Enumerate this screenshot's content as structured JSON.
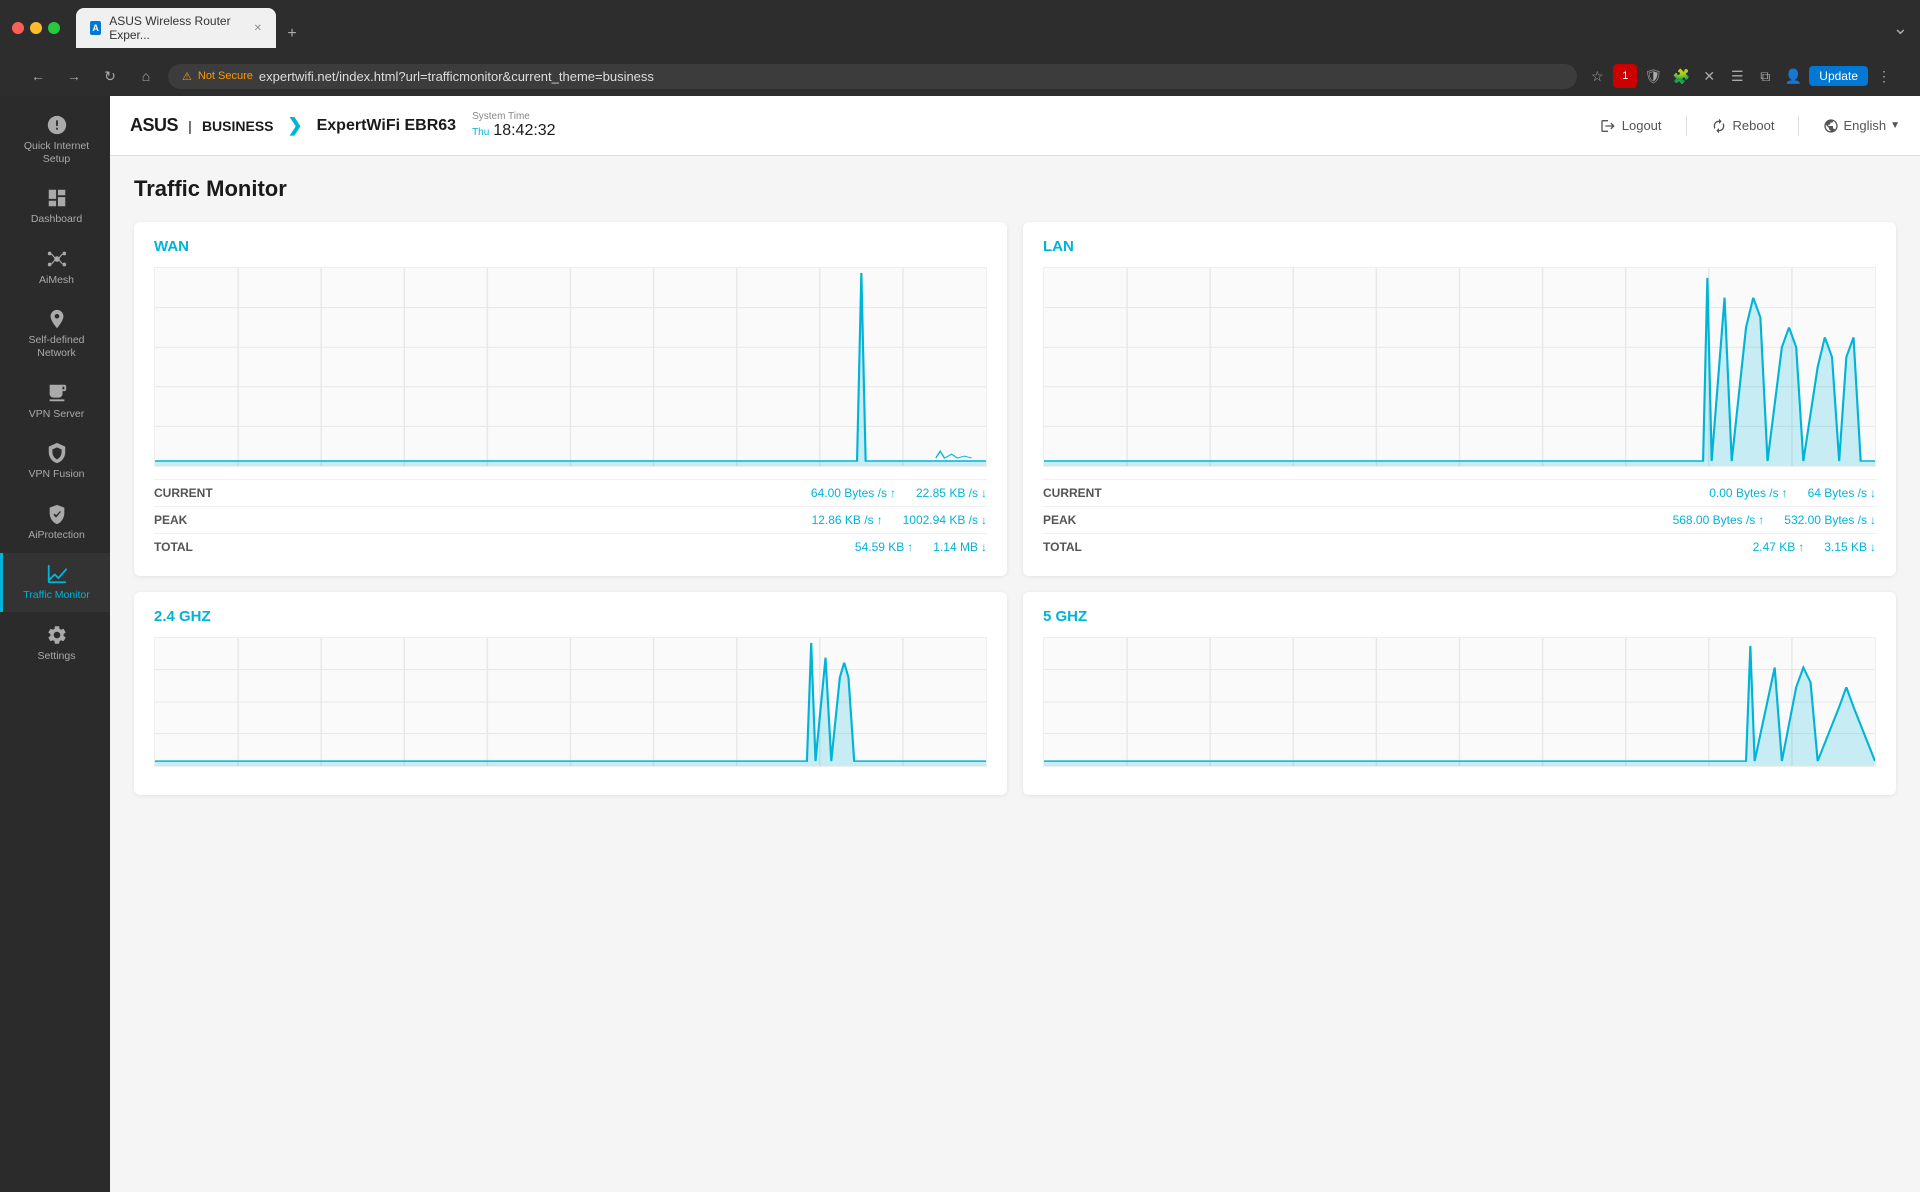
{
  "browser": {
    "tab_title": "ASUS Wireless Router Exper...",
    "new_tab_symbol": "+",
    "address": "expertwifi.net/index.html?url=trafficmonitor&current_theme=business",
    "not_secure_label": "Not Secure",
    "update_label": "Update"
  },
  "header": {
    "logo_asus": "ASUS",
    "logo_sep": "|",
    "logo_business": "BUSINESS",
    "router_name": "ExpertWiFi EBR63",
    "system_time_label": "System Time",
    "system_time_day": "Thu",
    "system_time_value": "18:42:32",
    "logout_label": "Logout",
    "reboot_label": "Reboot",
    "language_label": "English"
  },
  "sidebar": {
    "items": [
      {
        "id": "quick-internet-setup",
        "label": "Quick Internet\nSetup",
        "active": false
      },
      {
        "id": "dashboard",
        "label": "Dashboard",
        "active": false
      },
      {
        "id": "aimesh",
        "label": "AiMesh",
        "active": false
      },
      {
        "id": "self-defined-network",
        "label": "Self-defined\nNetwork",
        "active": false
      },
      {
        "id": "vpn-server",
        "label": "VPN Server",
        "active": false
      },
      {
        "id": "vpn-fusion",
        "label": "VPN Fusion",
        "active": false
      },
      {
        "id": "aiprotection",
        "label": "AiProtection",
        "active": false
      },
      {
        "id": "traffic-monitor",
        "label": "Traffic Monitor",
        "active": true
      },
      {
        "id": "settings",
        "label": "Settings",
        "active": false
      }
    ]
  },
  "page": {
    "title": "Traffic Monitor"
  },
  "wan": {
    "title": "WAN",
    "current_label": "CURRENT",
    "current_up": "64.00 Bytes /s",
    "current_down": "22.85 KB /s",
    "peak_label": "PEAK",
    "peak_up": "12.86 KB /s",
    "peak_down": "1002.94 KB /s",
    "total_label": "TOTAL",
    "total_up": "54.59 KB",
    "total_down": "1.14 MB"
  },
  "lan": {
    "title": "LAN",
    "current_label": "CURRENT",
    "current_up": "0.00 Bytes /s",
    "current_down": "64 Bytes /s",
    "peak_label": "PEAK",
    "peak_up": "568.00 Bytes /s",
    "peak_down": "532.00 Bytes /s",
    "total_label": "TOTAL",
    "total_up": "2.47 KB",
    "total_down": "3.15 KB"
  },
  "ghz24": {
    "title": "2.4 GHZ"
  },
  "ghz5": {
    "title": "5 GHZ"
  },
  "colors": {
    "accent": "#00b4d8",
    "chart_fill": "rgba(0,180,216,0.25)",
    "chart_stroke": "#00b4d8"
  }
}
